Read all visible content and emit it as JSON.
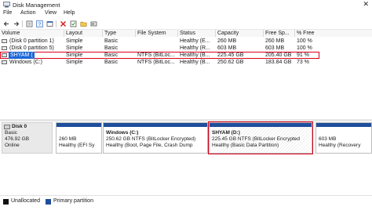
{
  "window": {
    "title": "Disk Management",
    "close_glyph": "✕"
  },
  "menu": [
    "File",
    "Action",
    "View",
    "Help"
  ],
  "toolbar": {
    "icons": [
      "back-arrow-icon",
      "forward-arrow-icon",
      "disk-list-icon",
      "help-icon",
      "properties-icon",
      "delete-icon",
      "settings-icon",
      "folder-icon",
      "disk-icon"
    ]
  },
  "table": {
    "columns": [
      "Volume",
      "Layout",
      "Type",
      "File System",
      "Status",
      "Capacity",
      "Free Sp...",
      "% Free"
    ],
    "rows": [
      [
        "(Disk 0 partition 1)",
        "Simple",
        "Basic",
        "",
        "Healthy (E...",
        "260 MB",
        "260 MB",
        "100 %"
      ],
      [
        "(Disk 0 partition 5)",
        "Simple",
        "Basic",
        "",
        "Healthy (R...",
        "603 MB",
        "603 MB",
        "100 %"
      ],
      [
        "SHYAM (",
        "Simple",
        "Basic",
        "NTFS (BitLoc...",
        "Healthy (B...",
        "225.45 GB",
        "205.40 GB",
        "91 %"
      ],
      [
        "Windows (C:)",
        "Simple",
        "Basic",
        "NTFS (BitLoc...",
        "Healthy (B...",
        "250.62 GB",
        "183.84 GB",
        "73 %"
      ]
    ]
  },
  "disk": {
    "name": "Disk 0",
    "type": "Basic",
    "size": "476.92 GB",
    "status": "Online"
  },
  "partitions": [
    {
      "name": "",
      "size": "260 MB",
      "status": "Healthy (EFI Sy"
    },
    {
      "name": "Windows  (C:)",
      "size": "250.62 GB NTFS (BitLocker Encrypted)",
      "status": "Healthy (Boot, Page File, Crash Dump"
    },
    {
      "name": "SHYAM  (D:)",
      "size": "225.45 GB NTFS (BitLocker Encrypted",
      "status": "Healthy (Basic Data Partition)"
    },
    {
      "name": "",
      "size": "603 MB",
      "status": "Healthy (Recovery"
    }
  ],
  "legend": [
    {
      "label": "Unallocated",
      "color": "#111111"
    },
    {
      "label": "Primary partition",
      "color": "#1f4e9c"
    }
  ],
  "colors": {
    "highlight": "#d9001b",
    "selection": "#1d66d6",
    "partition_bar": "#1f4e9c"
  }
}
